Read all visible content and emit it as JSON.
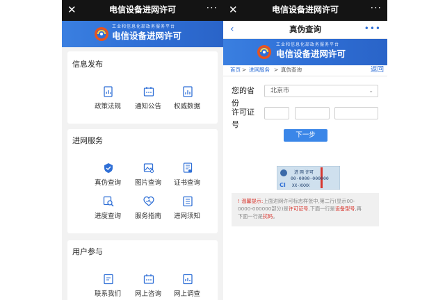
{
  "left": {
    "titlebar": {
      "close_glyph": "✕",
      "title": "电信设备进网许可",
      "more_glyph": "···"
    },
    "banner": {
      "small": "工业和信息化部政务服务平台",
      "big": "电信设备进网许可"
    },
    "sections": [
      {
        "title": "信息发布",
        "items": [
          {
            "label": "政策法规",
            "icon": "document-chart-icon"
          },
          {
            "label": "通知公告",
            "icon": "calendar-icon"
          },
          {
            "label": "权威数据",
            "icon": "data-report-icon"
          }
        ]
      },
      {
        "title": "进网服务",
        "items": [
          {
            "label": "真伪查询",
            "icon": "shield-check-icon"
          },
          {
            "label": "图片查询",
            "icon": "image-search-icon"
          },
          {
            "label": "证书查询",
            "icon": "certificate-icon"
          },
          {
            "label": "进度查询",
            "icon": "progress-search-icon"
          },
          {
            "label": "服务指南",
            "icon": "heart-guide-icon"
          },
          {
            "label": "进网须知",
            "icon": "notice-list-icon"
          }
        ]
      },
      {
        "title": "用户参与",
        "items": [
          {
            "label": "联系我们",
            "icon": "contact-doc-icon"
          },
          {
            "label": "网上咨询",
            "icon": "calendar-chat-icon"
          },
          {
            "label": "网上调查",
            "icon": "survey-icon"
          }
        ]
      }
    ]
  },
  "right": {
    "titlebar": {
      "close_glyph": "✕",
      "title": "电信设备进网许可",
      "more_glyph": "···"
    },
    "navbar": {
      "back_glyph": "‹",
      "title": "真伪查询",
      "more_glyph": "•••"
    },
    "banner": {
      "small": "工业和信息化部政务服务平台",
      "big": "电信设备进网许可"
    },
    "breadcrumb": {
      "home": "首页",
      "sep": ">",
      "service": "进网服务",
      "current": "真伪查询",
      "back": "返回"
    },
    "form": {
      "province_label_line1": "您的省",
      "province_label_line2": "份",
      "province_value": "北京市",
      "license_label_line1": "许可证",
      "license_label_line2": "号",
      "submit": "下一步"
    },
    "sample_label": {
      "top": "进 网 许可",
      "number": "00-0000-000000",
      "bottom": "XX-XXXX"
    },
    "tip": {
      "icon": "!",
      "heading": "温馨提示:",
      "l1a": "上面进网许可标志样张中,第二行(显示00-",
      "l2a": "0000-000000部分)是",
      "l2b": "许可证号",
      "l2c": ",下面一行是",
      "l2d": "设备型号",
      "l2e": ",再",
      "l3a": "下面一行是",
      "l3b": "扰码",
      "l3c": "。"
    },
    "colors": {
      "accent": "#2f6fd6",
      "button": "#3a86e8",
      "warning": "#d8372f"
    }
  }
}
